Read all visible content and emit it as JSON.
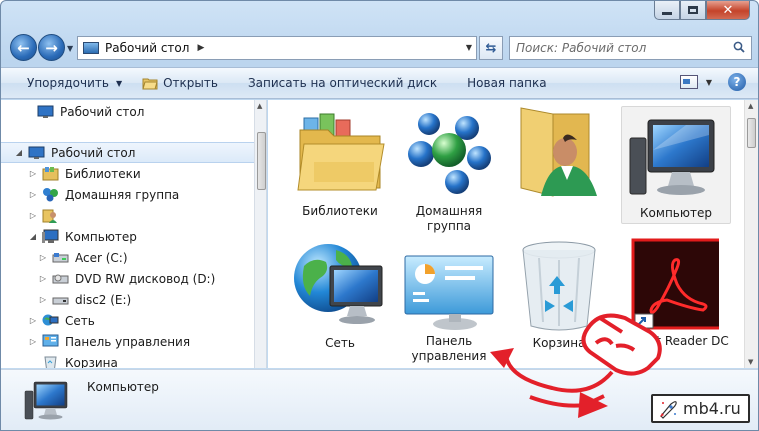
{
  "window": {
    "caption_buttons": [
      "minimize",
      "maximize",
      "close"
    ]
  },
  "nav": {
    "address": "Рабочий стол",
    "search_placeholder": "Поиск: Рабочий стол"
  },
  "toolbar": {
    "organize": "Упорядочить",
    "open": "Открыть",
    "burn": "Записать на оптический диск",
    "new_folder": "Новая папка"
  },
  "sidebar": {
    "items": [
      {
        "label": "Рабочий стол",
        "icon": "desktop-icon",
        "level": 0
      },
      {
        "label": "Рабочий стол",
        "icon": "desktop-icon",
        "level": 0,
        "selected": true,
        "expanded": true
      },
      {
        "label": "Библиотеки",
        "icon": "libraries-icon",
        "level": 1
      },
      {
        "label": "Домашняя группа",
        "icon": "homegroup-icon",
        "level": 1
      },
      {
        "label": "",
        "icon": "user-folder-icon",
        "level": 1
      },
      {
        "label": "Компьютер",
        "icon": "computer-icon",
        "level": 1,
        "expanded": true
      },
      {
        "label": "Acer (C:)",
        "icon": "drive-icon",
        "level": 2
      },
      {
        "label": "DVD RW дисковод (D:)",
        "icon": "dvd-drive-icon",
        "level": 2
      },
      {
        "label": "disc2 (E:)",
        "icon": "disc-drive-icon",
        "level": 2
      },
      {
        "label": "Сеть",
        "icon": "network-icon",
        "level": 1
      },
      {
        "label": "Панель управления",
        "icon": "control-panel-icon",
        "level": 1
      },
      {
        "label": "Корзина",
        "icon": "recycle-bin-icon",
        "level": 1
      }
    ]
  },
  "content": {
    "items": [
      {
        "label": "Библиотеки",
        "icon": "libraries-icon"
      },
      {
        "label": "Домашняя группа",
        "icon": "homegroup-icon"
      },
      {
        "label": "",
        "icon": "user-folder-icon"
      },
      {
        "label": "Компьютер",
        "icon": "computer-icon",
        "selected": true
      },
      {
        "label": "Сеть",
        "icon": "network-icon"
      },
      {
        "label": "Панель управления",
        "icon": "control-panel-icon"
      },
      {
        "label": "Корзина",
        "icon": "recycle-bin-icon"
      },
      {
        "label": "Acrobat Reader DC",
        "icon": "acrobat-icon",
        "visible_label": "obat Reader DC"
      }
    ]
  },
  "details": {
    "name": "Компьютер",
    "icon": "computer-icon"
  },
  "watermark": {
    "text": "mb4.ru"
  },
  "colors": {
    "annotation_red": "#e3202a",
    "selection_blue": "#dceaf9",
    "window_frame": "#bcd5ee"
  }
}
